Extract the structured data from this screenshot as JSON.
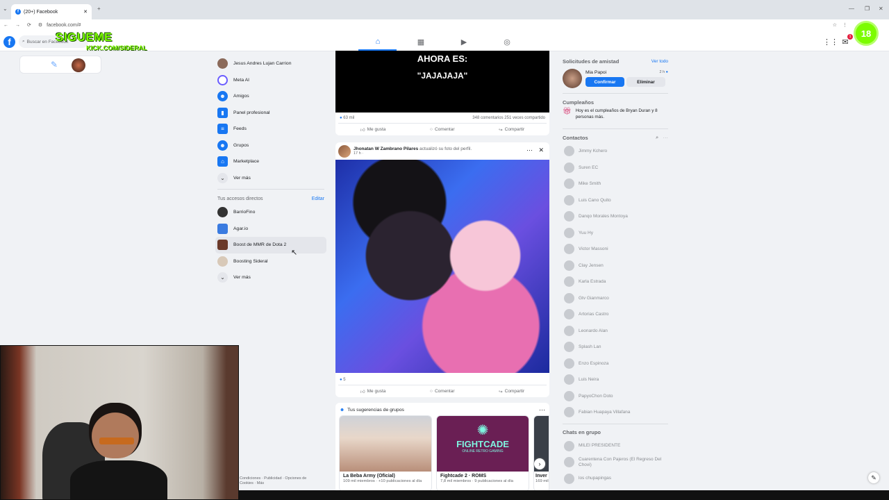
{
  "browser": {
    "tab_title": "(20+) Facebook",
    "new_tab": "+",
    "url": "facebook.com/#",
    "back": "←",
    "forward": "→",
    "reload": "⟳",
    "minimize": "—",
    "maximize": "❐",
    "close": "✕"
  },
  "header": {
    "logo": "f",
    "search_placeholder": "Buscar en Facebook",
    "overlay_follow": "SIGUEME",
    "overlay_kick": "KICK.COM/SIDERAL",
    "age_badge": "18",
    "notif_count": "1"
  },
  "leftmenu": {
    "items": [
      {
        "label": "Jesus Andres Lujan Carrion",
        "color": "#8b6a5a"
      },
      {
        "label": "Meta AI",
        "color": "#6a5cff"
      },
      {
        "label": "Amigos",
        "color": "#1877f2"
      },
      {
        "label": "Panel profesional",
        "color": "#1877f2"
      },
      {
        "label": "Feeds",
        "color": "#1877f2"
      },
      {
        "label": "Grupos",
        "color": "#1877f2"
      },
      {
        "label": "Marketplace",
        "color": "#1877f2"
      },
      {
        "label": "Ver más",
        "color": "#e4e6eb"
      }
    ],
    "shortcuts_title": "Tus accesos directos",
    "shortcuts_edit": "Editar",
    "shortcuts": [
      {
        "label": "BarrioFino"
      },
      {
        "label": "Agar.io"
      },
      {
        "label": "Boost de MMR de Dota 2"
      },
      {
        "label": "Boosting Sideral"
      },
      {
        "label": "Ver más"
      }
    ],
    "footer": "Condiciones · Publicidad · Opciones de Cookies · Más"
  },
  "feed": {
    "post1": {
      "meme_line1": "AHORA ES:",
      "meme_line2": "\"JAJAJAJA\"",
      "reactions": "63 mil",
      "stats": "348 comentarios   251 veces compartido",
      "like": "Me gusta",
      "comment": "Comentar",
      "share": "Compartir"
    },
    "post2": {
      "author": "Jhonatan W Zambrano Pilares",
      "action": "actualizó su foto del perfil.",
      "time": "17 h · ",
      "reactions": "5",
      "like": "Me gusta",
      "comment": "Comentar",
      "share": "Compartir"
    },
    "groups": {
      "title": "Tus sugerencias de grupos",
      "items": [
        {
          "name": "La Beba Army (Oficial)",
          "meta": "109 mil miembros · +10 publicaciones al día"
        },
        {
          "name": "Fightcade 2 · ROMS",
          "meta": "7,8 mil miembros · 9 publicaciones al día"
        },
        {
          "name": "Inver",
          "meta": "169 mil"
        }
      ],
      "fightcade_logo": "FIGHTCADE",
      "fightcade_sub": "ONLINE RETRO GAMING"
    }
  },
  "right": {
    "requests_title": "Solicitudes de amistad",
    "see_all": "Ver todo",
    "request_name": "Mia Papoi",
    "request_time": "2 h",
    "confirm": "Confirmar",
    "delete": "Eliminar",
    "birthdays_title": "Cumpleaños",
    "birthday_text": "Hoy es el cumpleaños de Bryan Duran y 8 personas más.",
    "contacts_title": "Contactos",
    "contacts": [
      "Jimmy Kchero",
      "Suren EC",
      "Mike Smith",
      "Luis Cano Quito",
      "Danqo Morales Montoya",
      "Yuu Hy",
      "Victor Massoni",
      "Clay Jensen",
      "Karla Estrada",
      "Gtv Gianmarco",
      "Artorias Castro",
      "Leonardo Alan",
      "Splash Lan",
      "Enzo Espinoza",
      "Luis Neira",
      "PapyoChon Doto",
      "Fabian Huapaya Villafana"
    ],
    "group_chats_title": "Chats en grupo",
    "group_chats": [
      "MILEI PRESIDENTE",
      "Cuarentena Con Pajeros (El Regreso Del Chovi)",
      "los chupapingas"
    ]
  }
}
